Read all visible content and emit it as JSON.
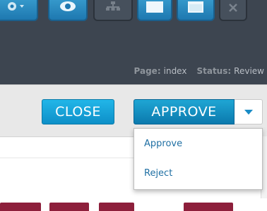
{
  "header": {
    "page_label": "Page:",
    "page_value": "index",
    "status_label": "Status:",
    "status_value": "Review"
  },
  "toolbar": {
    "icons": [
      "gear-icon",
      "eye-icon",
      "sitemap-icon",
      "window-icon",
      "window-icon",
      "close-icon"
    ]
  },
  "actions": {
    "close_label": "CLOSE",
    "approve_label": "APPROVE"
  },
  "dropdown": {
    "items": [
      "Approve",
      "Reject"
    ]
  },
  "colors": {
    "header_bg": "#3d4550",
    "accent_blue": "#1a8cc6",
    "pill_maroon": "#8d1f3b"
  }
}
